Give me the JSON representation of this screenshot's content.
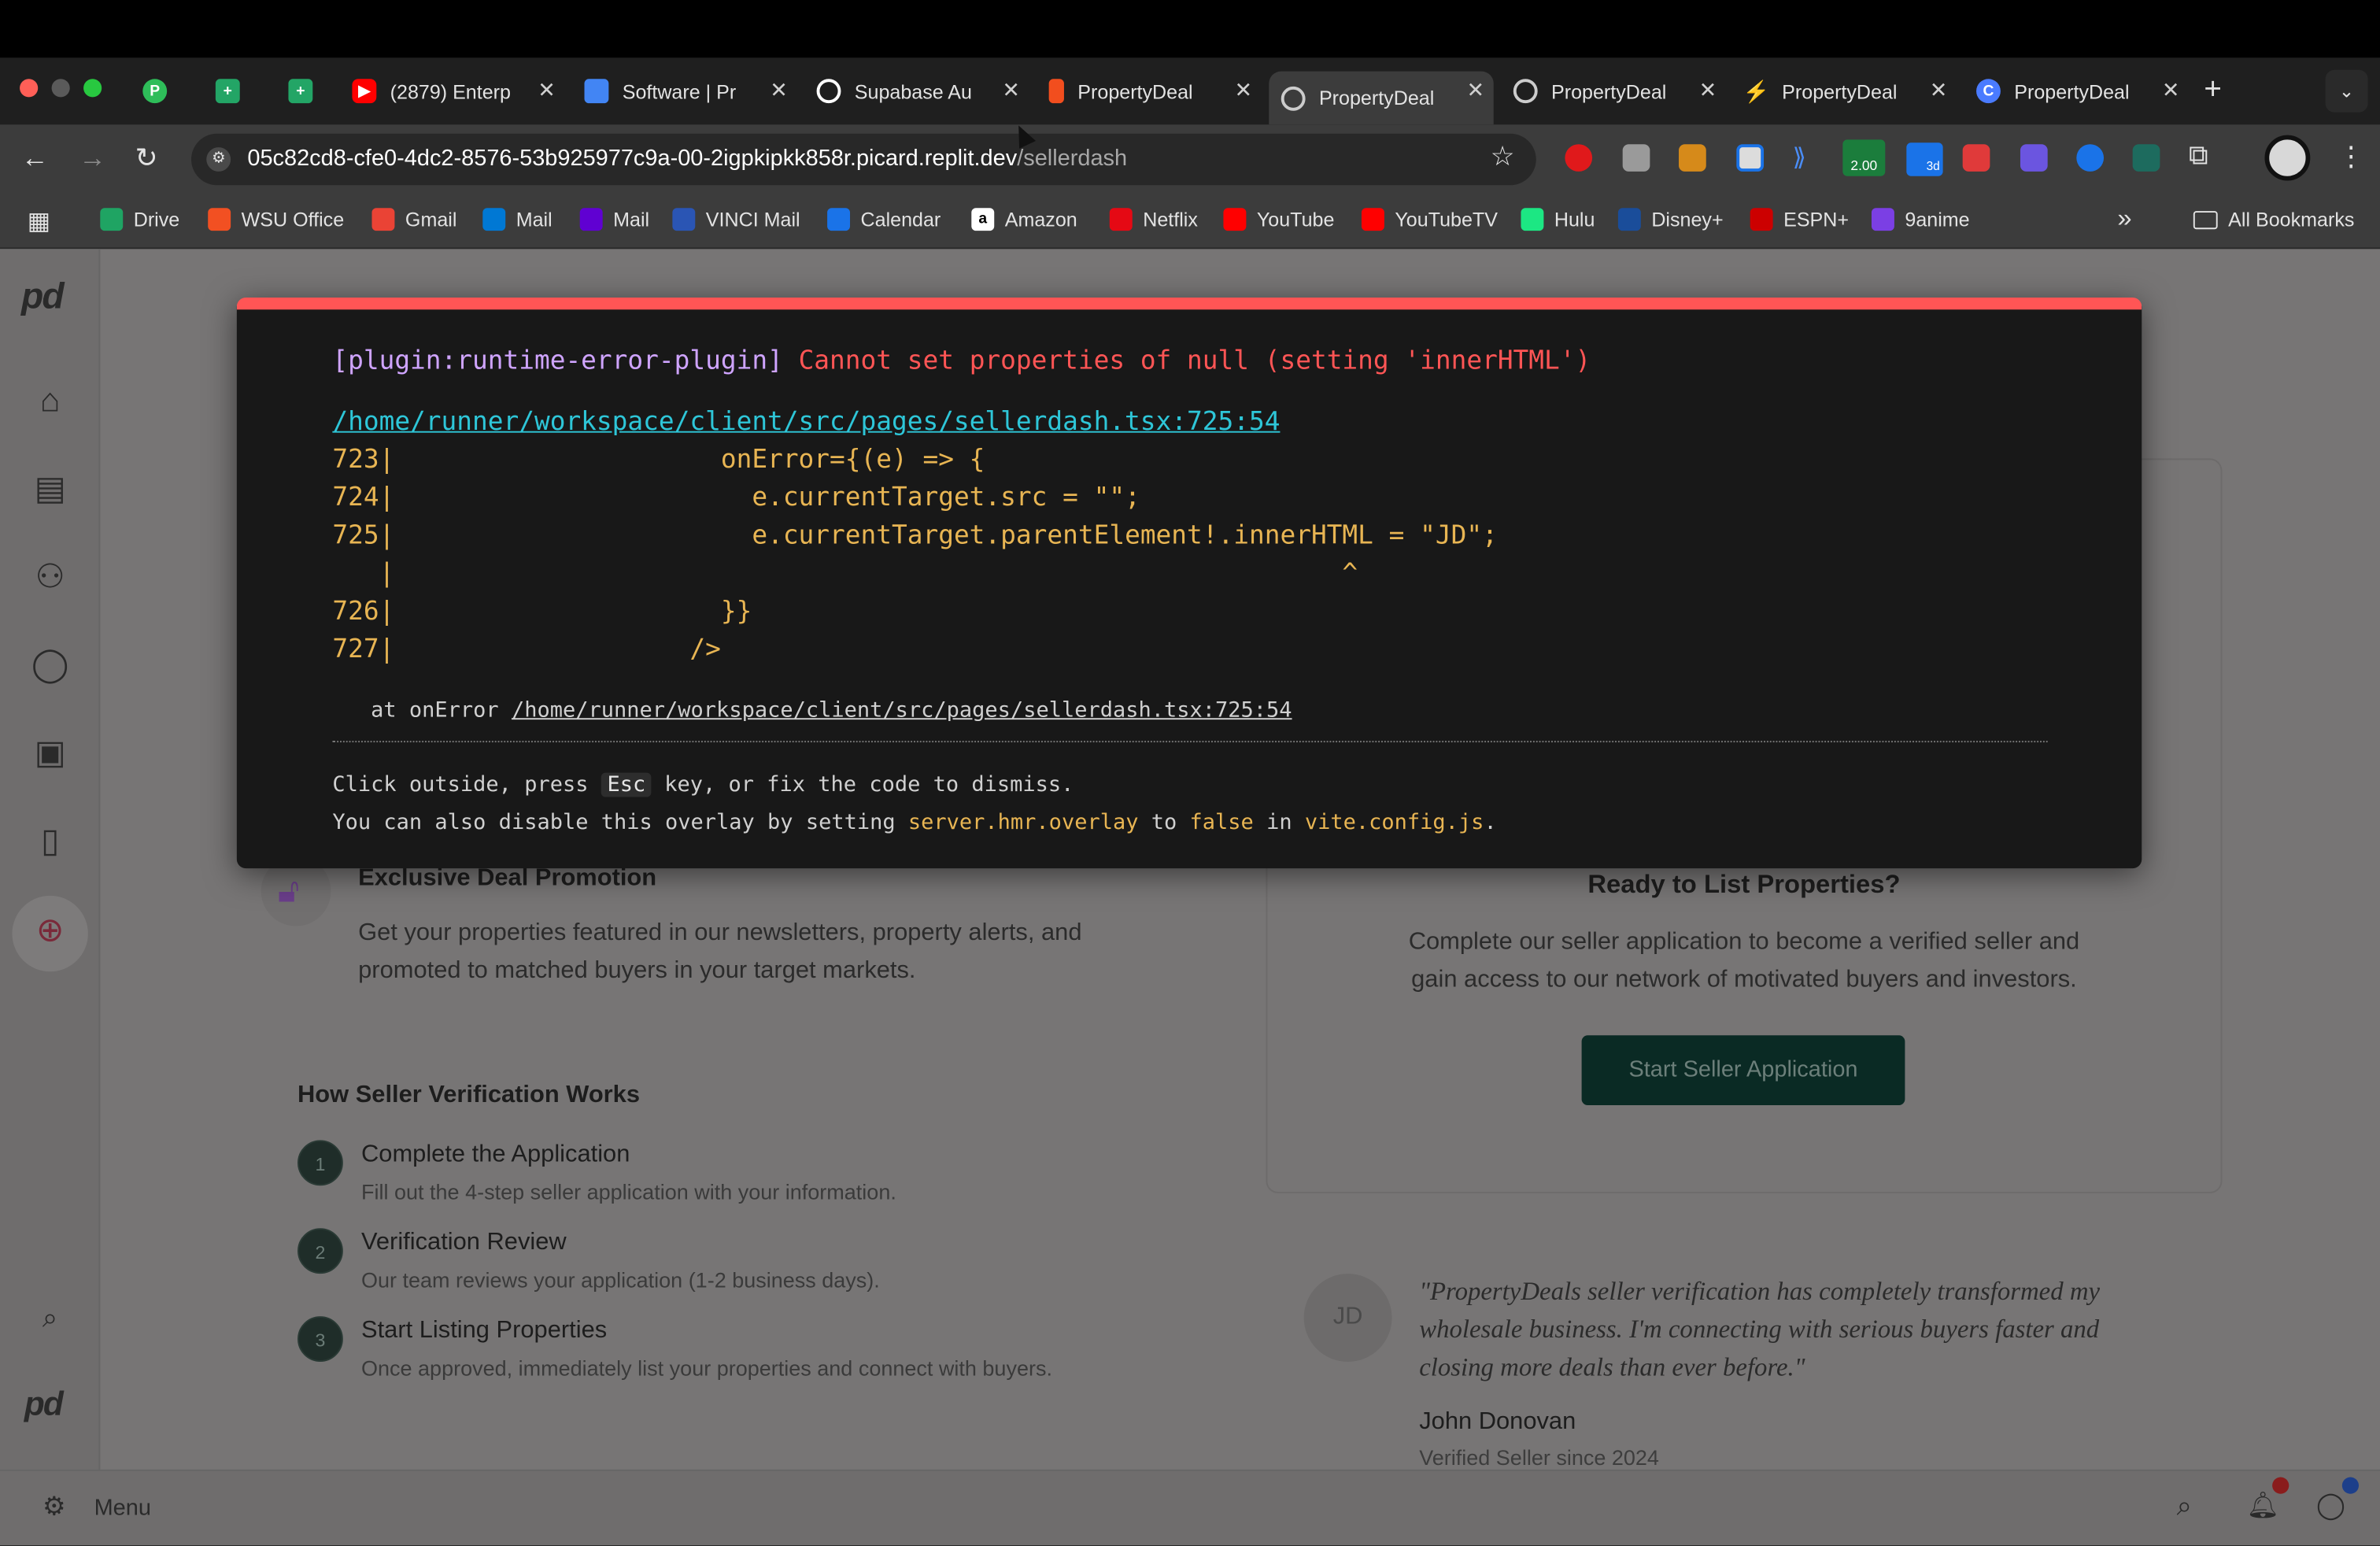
{
  "browser": {
    "tabs": [
      {
        "label": "",
        "icon": "p-icon",
        "color": "#2ebd59"
      },
      {
        "label": "",
        "icon": "sheets-icon",
        "color": "#23a566"
      },
      {
        "label": "",
        "icon": "sheets-icon",
        "color": "#23a566"
      },
      {
        "label": "(2879) Enterp",
        "icon": "youtube-icon",
        "color": "#ff0000"
      },
      {
        "label": "Software | Pr",
        "icon": "docs-icon",
        "color": "#4285f4"
      },
      {
        "label": "Supabase Au",
        "icon": "openai-icon",
        "color": "#ffffff"
      },
      {
        "label": "PropertyDeal",
        "icon": "figma-icon",
        "color": "#f24e1e"
      },
      {
        "label": "PropertyDeal",
        "icon": "globe-icon",
        "color": "#cccccc"
      },
      {
        "label": "PropertyDeal",
        "icon": "globe-icon",
        "color": "#cccccc"
      },
      {
        "label": "PropertyDeal",
        "icon": "bolt-icon",
        "color": "#3ecf8e"
      },
      {
        "label": "PropertyDeal",
        "icon": "c-icon",
        "color": "#4a7bff"
      }
    ],
    "new_tab": "+",
    "url_main": "05c82cd8-cfe0-4dc2-8576-53b925977c9a-00-2igpkipkk858r.picard.replit.dev",
    "url_path": "/sellerdash",
    "badge_ext": "2.00",
    "badge_ext2": "3d",
    "bookmarks": [
      "Drive",
      "WSU Office",
      "Gmail",
      "Mail",
      "Mail",
      "VINCI Mail",
      "Calendar",
      "Amazon",
      "Netflix",
      "YouTube",
      "YouTubeTV",
      "Hulu",
      "Disney+",
      "ESPN+",
      "9anime"
    ],
    "more_bookmarks": "»",
    "all_bookmarks": "All Bookmarks"
  },
  "error_overlay": {
    "plugin": "[plugin:runtime-error-plugin]",
    "message": "Cannot set properties of null (setting 'innerHTML')",
    "file_link": "/home/runner/workspace/client/src/pages/sellerdash.tsx:725:54",
    "code_lines": [
      {
        "num": "723|",
        "code": "                     onError={(e) => {"
      },
      {
        "num": "724|",
        "code": "                       e.currentTarget.src = \"\";"
      },
      {
        "num": "725|",
        "code": "                       e.currentTarget.parentElement!.innerHTML = \"JD\";"
      },
      {
        "num": "   |",
        "code": "                                                             ^"
      },
      {
        "num": "726|",
        "code": "                     }}"
      },
      {
        "num": "727|",
        "code": "                   />"
      }
    ],
    "stack_prefix": "   at onError ",
    "stack_link": "/home/runner/workspace/client/src/pages/sellerdash.tsx:725:54",
    "tip1_a": "Click outside, press ",
    "tip1_key": "Esc",
    "tip1_b": " key, or fix the code to dismiss.",
    "tip2_a": "You can also disable this overlay by setting ",
    "tip2_setting": "server.hmr.overlay",
    "tip2_b": " to ",
    "tip2_false": "false",
    "tip2_c": " in ",
    "tip2_file": "vite.config.js",
    "tip2_d": "."
  },
  "page": {
    "promo_title": "Exclusive Deal Promotion",
    "promo_text_1": "Get your properties featured in our newsletters, property alerts, and",
    "promo_text_2": "promoted to matched buyers in your target markets.",
    "how_title": "How Seller Verification Works",
    "steps": [
      {
        "num": "1",
        "title": "Complete the Application",
        "desc": "Fill out the 4-step seller application with your information."
      },
      {
        "num": "2",
        "title": "Verification Review",
        "desc": "Our team reviews your application (1-2 business days)."
      },
      {
        "num": "3",
        "title": "Start Listing Properties",
        "desc": "Once approved, immediately list your properties and connect with buyers."
      }
    ],
    "ready_title": "Ready to List Properties?",
    "ready_text_1": "Complete our seller application to become a verified seller and",
    "ready_text_2": "gain access to our network of motivated buyers and investors.",
    "cta_label": "Start Seller Application",
    "testimonial_avatar": "JD",
    "testimonial_1": "\"PropertyDeals seller verification has completely transformed my",
    "testimonial_2": "wholesale business. I'm connecting with serious buyers faster and",
    "testimonial_3": "closing more deals than ever before.\"",
    "testimonial_name": "John Donovan",
    "testimonial_role": "Verified Seller since 2024",
    "menu_label": "Menu",
    "logo_text": "pd"
  }
}
